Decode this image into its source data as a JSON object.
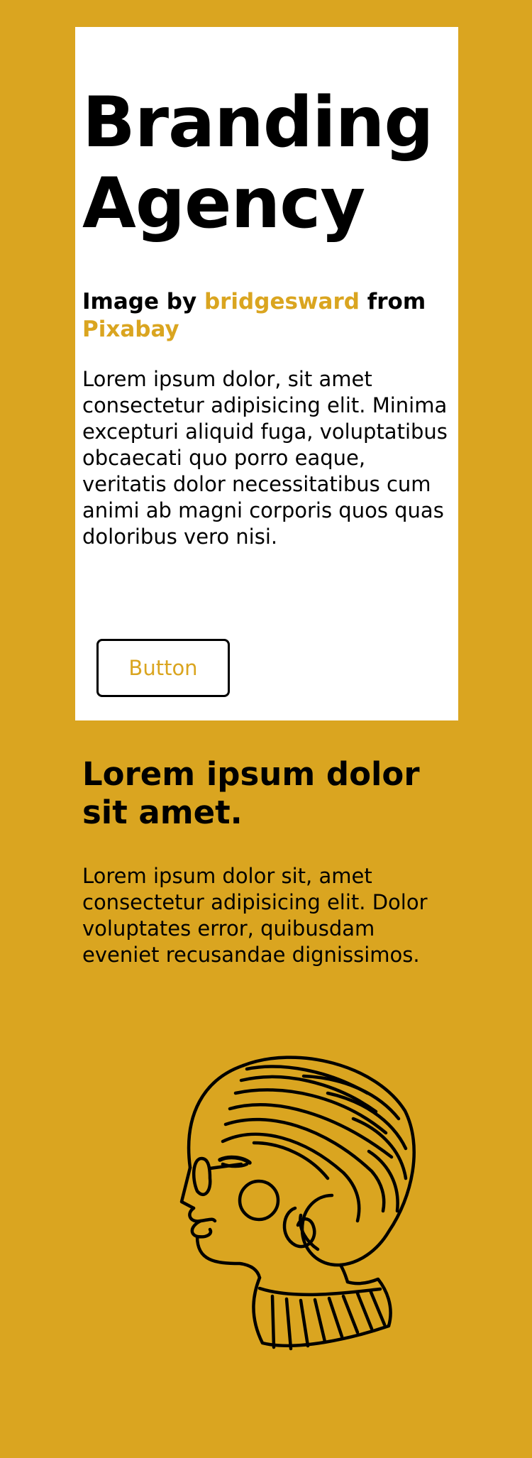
{
  "hero": {
    "title": "Branding Agency",
    "credit_prefix": "Image by ",
    "credit_author": "bridgesward",
    "credit_middle": " from ",
    "credit_source": "Pixabay",
    "body": "Lorem ipsum dolor, sit amet consectetur adipisicing elit. Minima excepturi aliquid fuga, voluptatibus obcaecati quo porro eaque, veritatis dolor necessitatibus cum animi ab magni corporis quos quas doloribus vero nisi.",
    "button_label": "Button"
  },
  "section": {
    "title": "Lorem ipsum dolor sit amet.",
    "body": "Lorem ipsum dolor sit, amet consectetur adipisicing elit. Dolor voluptates error, quibusdam eveniet recusandae dignissimos."
  },
  "illustration": {
    "icon": "woman-portrait-line-art",
    "stroke_color": "#000000"
  },
  "colors": {
    "background": "#DAA520",
    "accent": "#DAA520",
    "card": "#FFFFFF"
  }
}
